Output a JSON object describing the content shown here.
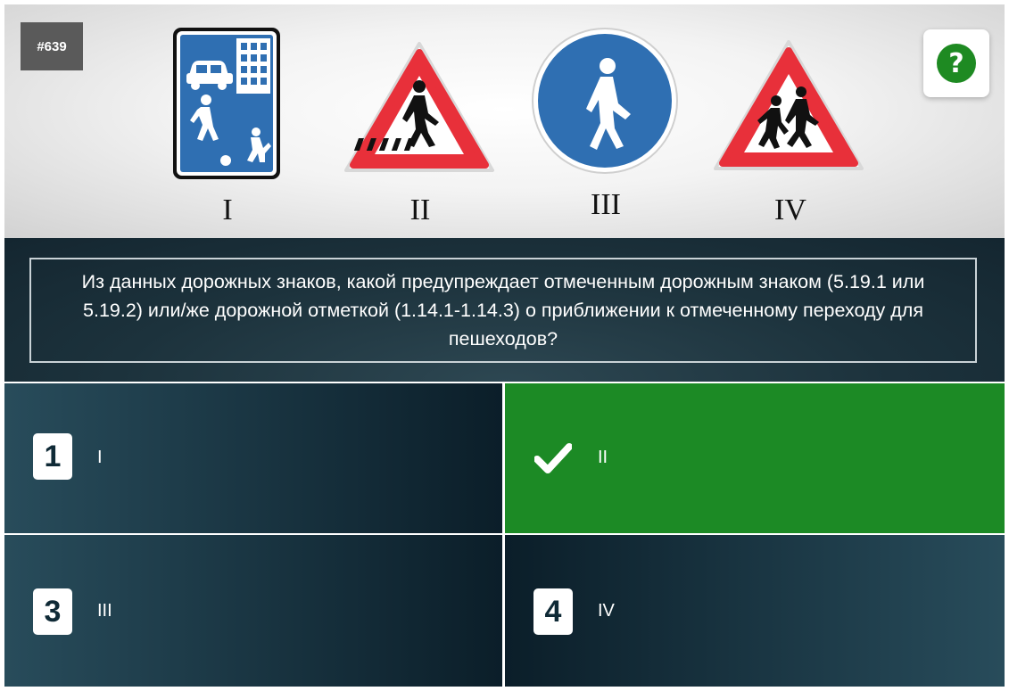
{
  "question_number": "#639",
  "help_icon": "?",
  "signs": [
    {
      "roman": "I",
      "icon": "living-zone-sign-icon"
    },
    {
      "roman": "II",
      "icon": "pedestrian-crossing-warning-sign-icon"
    },
    {
      "roman": "III",
      "icon": "pedestrian-path-sign-icon"
    },
    {
      "roman": "IV",
      "icon": "children-warning-sign-icon"
    }
  ],
  "question_text": "Из данных дорожных знаков, какой предупреждает отмеченным дорожным знаком (5.19.1 или 5.19.2) или/же дорожной отметкой (1.14.1-1.14.3) о приближении к отмеченному переходу для пешеходов?",
  "answers": [
    {
      "number": "1",
      "text": "I",
      "state": "default"
    },
    {
      "number": "2",
      "text": "II",
      "state": "correct",
      "icon": "checkmark-icon"
    },
    {
      "number": "3",
      "text": "III",
      "state": "default"
    },
    {
      "number": "4",
      "text": "IV",
      "state": "default"
    }
  ],
  "colors": {
    "correct": "#1c8a25",
    "help_green": "#1e8a22",
    "sign_blue": "#2f6fb2",
    "sign_red": "#e8303a",
    "panel_dark": "#0b1e29"
  }
}
